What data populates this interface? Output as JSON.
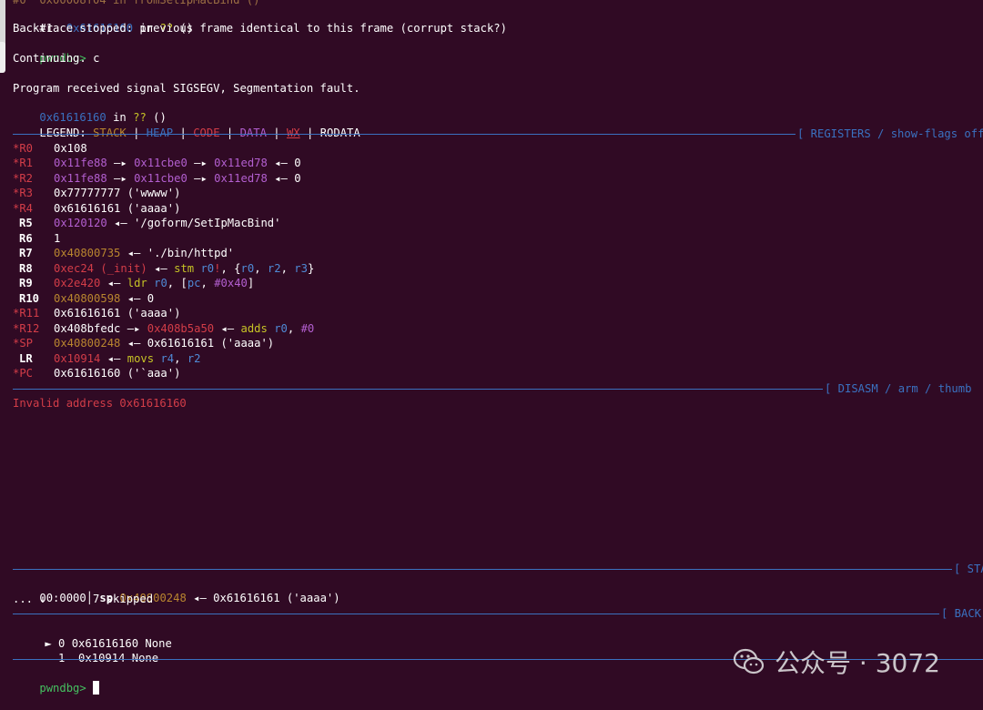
{
  "backtrace": {
    "frame0_partial": "#0  0x00008f04 in fromSetIpMacBind ()",
    "frame1_num": "#1",
    "frame1_addr": "0x61616160",
    "frame1_in": "in",
    "frame1_fn": "??",
    "frame1_paren": "()",
    "stopped": "Backtrace stopped: previous frame identical to this frame (corrupt stack?)"
  },
  "prompt": "pwndbg>",
  "cmd_continue": "c",
  "continuing": "Continuing.",
  "signal_msg": "Program received signal SIGSEGV, Segmentation fault.",
  "fault_addr": "0x61616160",
  "fault_in": "in",
  "fault_fn": "??",
  "fault_paren": "()",
  "legend": {
    "prefix": "LEGEND:",
    "stack": "STACK",
    "heap": "HEAP",
    "code": "CODE",
    "data": "DATA",
    "wx": "WX",
    "rodata": "RODATA",
    "sep": "|"
  },
  "sections": {
    "registers": "[ REGISTERS / show-flags off",
    "disasm": "[ DISASM / arm / thumb",
    "stack": "[ STA",
    "backtrace": "[ BACK"
  },
  "registers": [
    {
      "name": "*R0",
      "value": "0x108"
    },
    {
      "name": "*R1",
      "value": "0x11fe88 —▸ 0x11cbe0 —▸ 0x11ed78 ◂— 0"
    },
    {
      "name": "*R2",
      "value": "0x11fe88 —▸ 0x11cbe0 —▸ 0x11ed78 ◂— 0"
    },
    {
      "name": "*R3",
      "value": "0x77777777 ('wwww')"
    },
    {
      "name": "*R4",
      "value": "0x61616161 ('aaaa')"
    },
    {
      "name": "R5",
      "value": "0x120120 ◂— '/goform/SetIpMacBind'"
    },
    {
      "name": "R6",
      "value": "1"
    },
    {
      "name": "R7",
      "value": "0x40800735 ◂— './bin/httpd'"
    },
    {
      "name": "R8",
      "value": "0xec24 (_init) ◂— stm r0!, {r0, r2, r3}"
    },
    {
      "name": "R9",
      "value": "0x2e420 ◂— ldr r0, [pc, #0x40]"
    },
    {
      "name": "R10",
      "value": "0x40800598 ◂— 0"
    },
    {
      "name": "*R11",
      "value": "0x61616161 ('aaaa')"
    },
    {
      "name": "*R12",
      "value": "0x408bfedc —▸ 0x408b5a50 ◂— adds r0, #0"
    },
    {
      "name": "*SP",
      "value": "0x40800248 ◂— 0x61616161 ('aaaa')"
    },
    {
      "name": "LR",
      "value": "0x10914 ◂— movs r4, r2"
    },
    {
      "name": "*PC",
      "value": "0x61616160 ('`aaa')"
    }
  ],
  "disasm_error": "Invalid address 0x61616160",
  "stack_rows": {
    "row0_offset": "00:0000│",
    "row0_reg": "sp",
    "row0_addr": "0x40800248",
    "row0_rest": "◂— 0x61616161 ('aaaa')",
    "row1": "... ↓       7 skipped"
  },
  "bt_rows": [
    {
      "marker": "►",
      "text": "0 0x61616160 None"
    },
    {
      "marker": " ",
      "text": "1  0x10914 None"
    }
  ],
  "watermark": "公众号 · 3072",
  "colors": {
    "background": "#300a24",
    "blue": "#3a71c0",
    "red": "#d33d48",
    "purple": "#b35fd0",
    "yellow": "#c6c326"
  }
}
